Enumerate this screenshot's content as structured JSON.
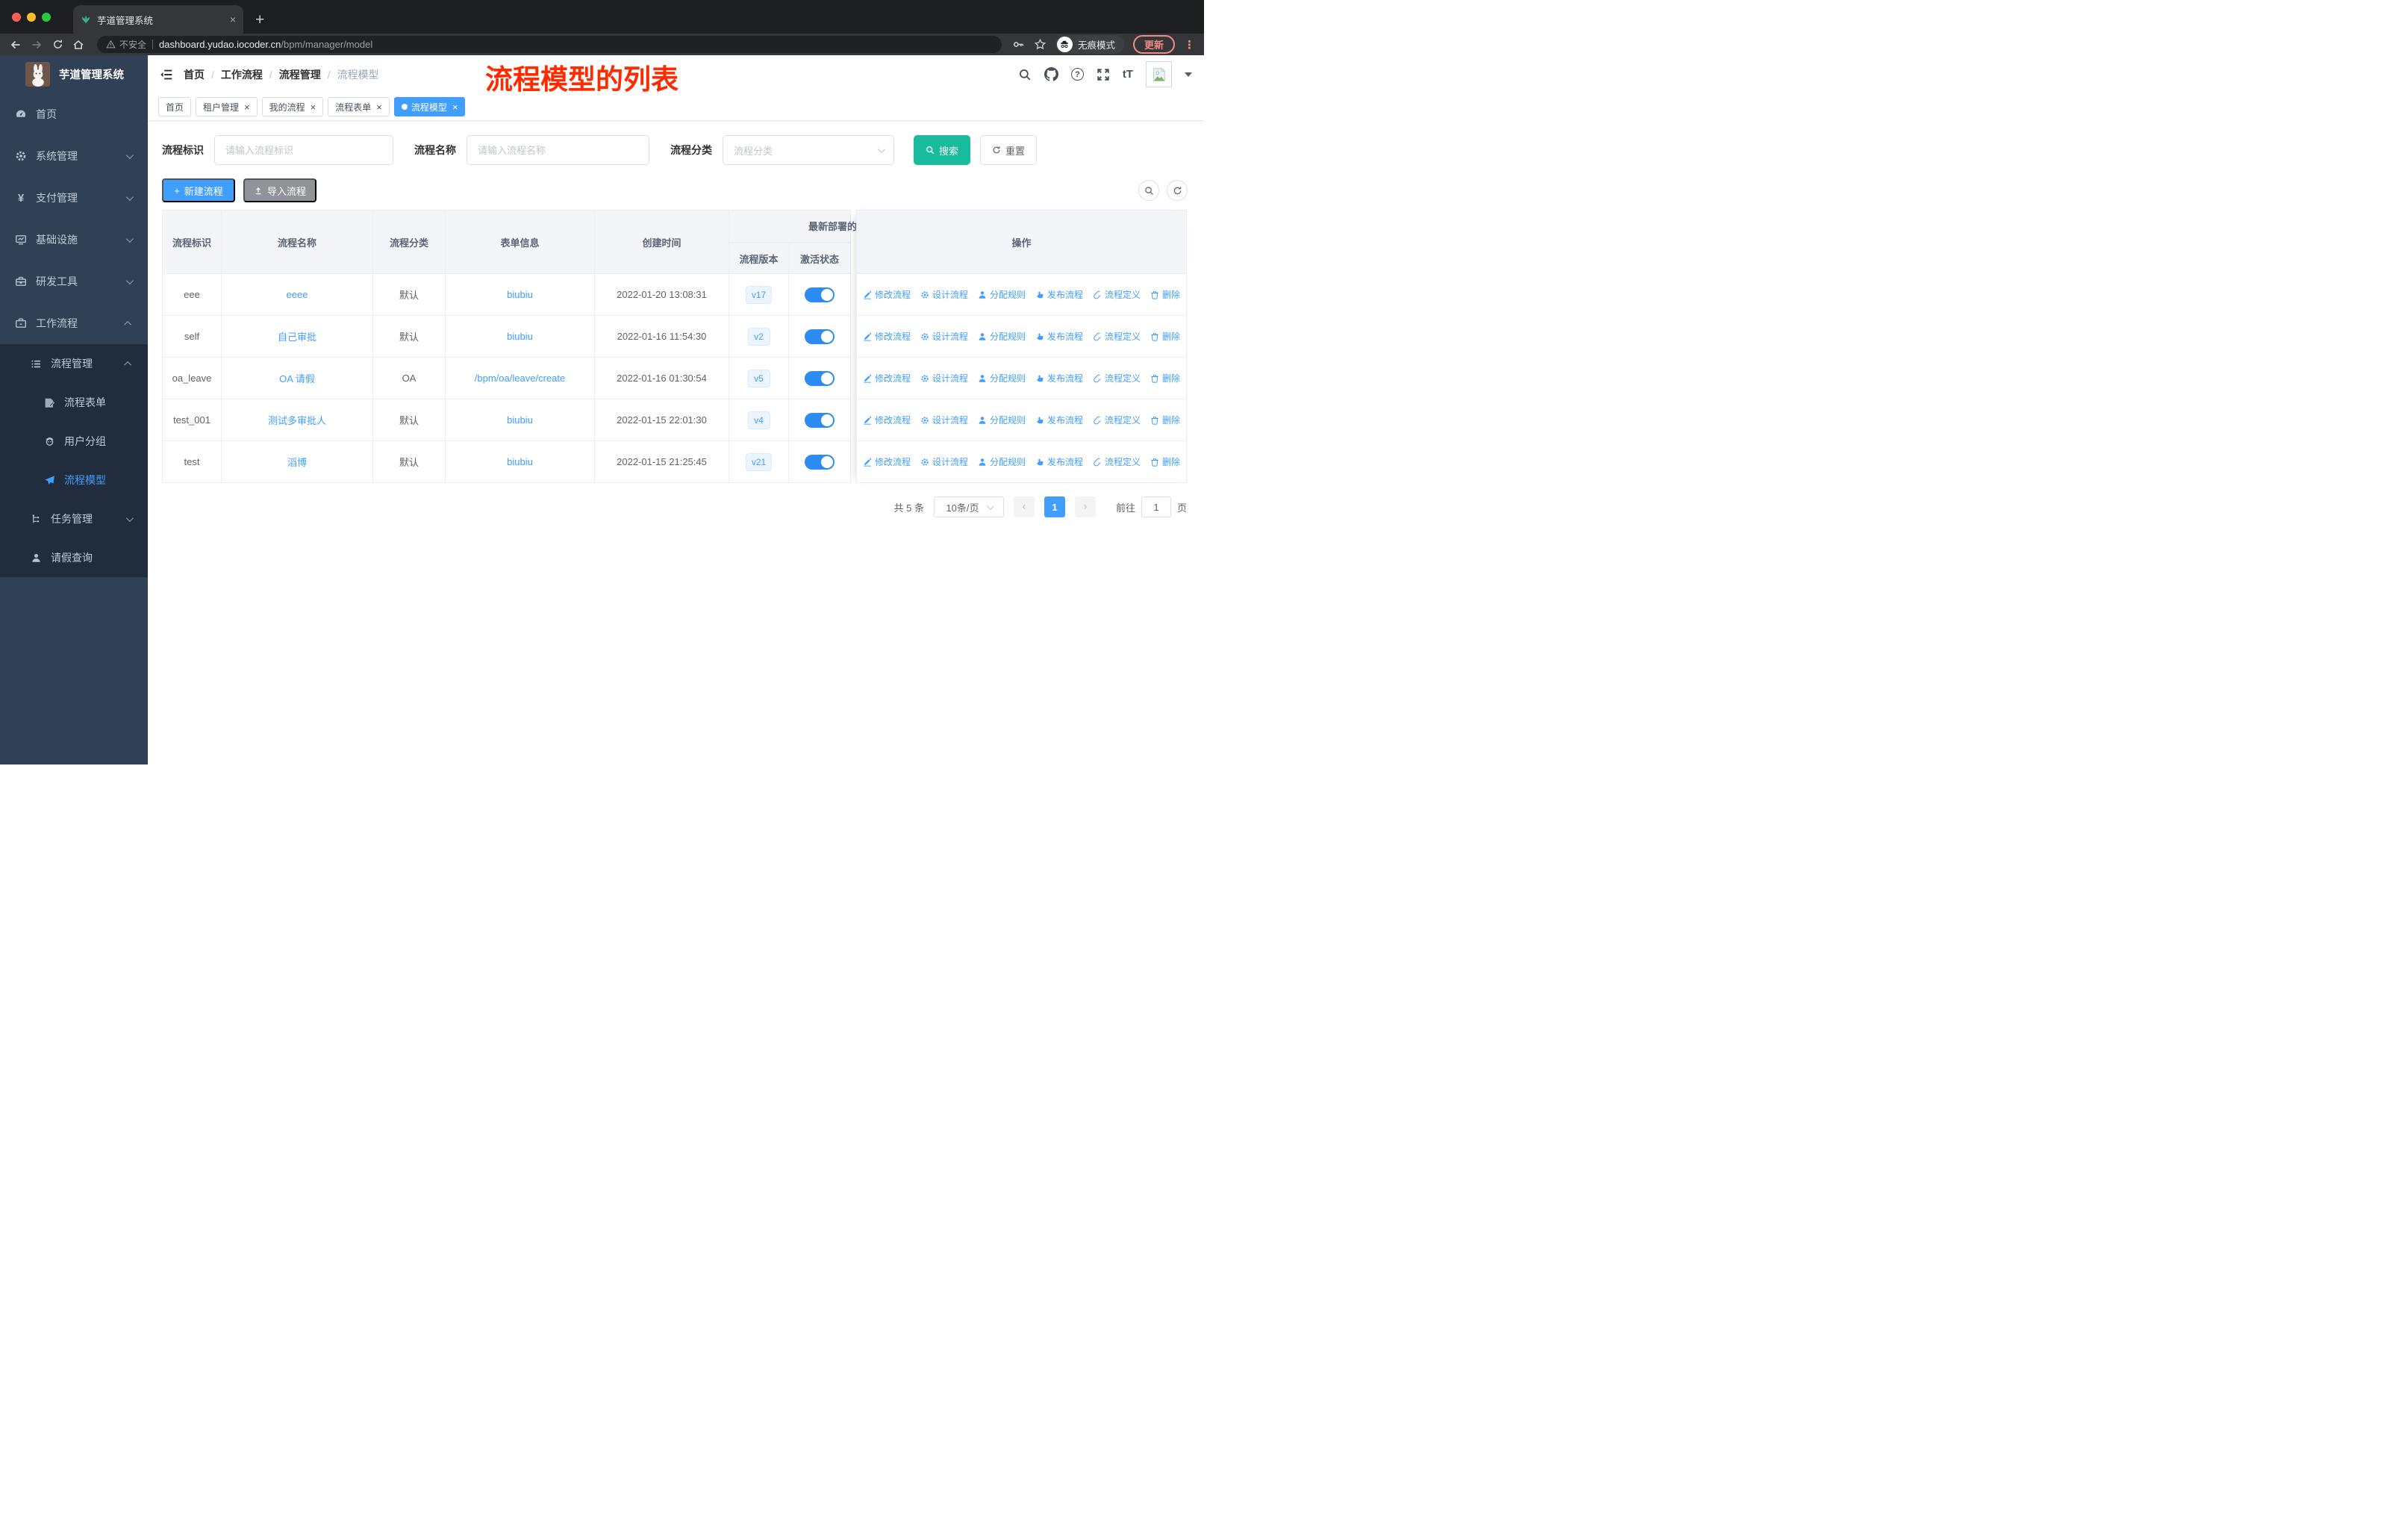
{
  "browser": {
    "tab_title": "芋道管理系统",
    "security_label": "不安全",
    "url_host": "dashboard.yudao.iocoder.cn",
    "url_path": "/bpm/manager/model",
    "incognito_label": "无痕模式",
    "update_label": "更新"
  },
  "icons": {
    "close": "×",
    "plus": "+",
    "more_vertical": "⋮",
    "help": "?",
    "font_size": "tT",
    "yen": "¥",
    "prev": "‹",
    "next": "›"
  },
  "sidebar": {
    "app_title": "芋道管理系统",
    "menu": [
      {
        "label": "首页"
      },
      {
        "label": "系统管理"
      },
      {
        "label": "支付管理"
      },
      {
        "label": "基础设施"
      },
      {
        "label": "研发工具"
      },
      {
        "label": "工作流程"
      }
    ],
    "submenu": {
      "process_mgmt": "流程管理",
      "process_form": "流程表单",
      "user_group": "用户分组",
      "process_model": "流程模型",
      "task_mgmt": "任务管理",
      "leave_query": "请假查询"
    }
  },
  "header": {
    "breadcrumbs": [
      "首页",
      "工作流程",
      "流程管理",
      "流程模型"
    ],
    "separator": "/",
    "annotation": "流程模型的列表"
  },
  "tags_view": {
    "tags": [
      {
        "label": "首页",
        "active": false,
        "closable": false
      },
      {
        "label": "租户管理",
        "active": false,
        "closable": true
      },
      {
        "label": "我的流程",
        "active": false,
        "closable": true
      },
      {
        "label": "流程表单",
        "active": false,
        "closable": true
      },
      {
        "label": "流程模型",
        "active": true,
        "closable": true
      }
    ]
  },
  "filters": {
    "process_key_label": "流程标识",
    "process_key_placeholder": "请输入流程标识",
    "process_name_label": "流程名称",
    "process_name_placeholder": "请输入流程名称",
    "category_label": "流程分类",
    "category_placeholder": "流程分类",
    "search_label": "搜索",
    "reset_label": "重置"
  },
  "toolbar": {
    "create_label": "新建流程",
    "import_label": "导入流程"
  },
  "table": {
    "columns": {
      "key": "流程标识",
      "name": "流程名称",
      "category": "流程分类",
      "form": "表单信息",
      "create_time": "创建时间",
      "deploy_group": "最新部署的",
      "version": "流程版本",
      "active_state": "激活状态",
      "actions": "操作"
    },
    "action_labels": [
      "修改流程",
      "设计流程",
      "分配规则",
      "发布流程",
      "流程定义",
      "删除"
    ],
    "rows": [
      {
        "key": "eee",
        "name": "eeee",
        "category": "默认",
        "form": "biubiu",
        "create_time": "2022-01-20 13:08:31",
        "version": "v17",
        "active": true
      },
      {
        "key": "self",
        "name": "自己审批",
        "category": "默认",
        "form": "biubiu",
        "create_time": "2022-01-16 11:54:30",
        "version": "v2",
        "active": true
      },
      {
        "key": "oa_leave",
        "name": "OA 请假",
        "category": "OA",
        "form": "/bpm/oa/leave/create",
        "create_time": "2022-01-16 01:30:54",
        "version": "v5",
        "active": true
      },
      {
        "key": "test_001",
        "name": "测试多审批人",
        "category": "默认",
        "form": "biubiu",
        "create_time": "2022-01-15 22:01:30",
        "version": "v4",
        "active": true
      },
      {
        "key": "test",
        "name": "滔博",
        "category": "默认",
        "form": "biubiu",
        "create_time": "2022-01-15 21:25:45",
        "version": "v21",
        "active": true
      }
    ]
  },
  "pagination": {
    "total": "共 5 条",
    "page_size": "10条/页",
    "current_page": "1",
    "goto_label": "前往",
    "goto_value": "1",
    "page_unit": "页"
  },
  "colors": {
    "primary": "#409eff",
    "search_button": "#18bc9c",
    "import_button": "#909399",
    "annotation_red": "#ff2b00",
    "sidebar_bg": "#304156",
    "submenu_bg": "#212d3d",
    "toggle_on": "#2d8cf0",
    "link": "#409eff",
    "update_button": "#f08b82",
    "version_tag_bg": "#ecf5ff"
  }
}
